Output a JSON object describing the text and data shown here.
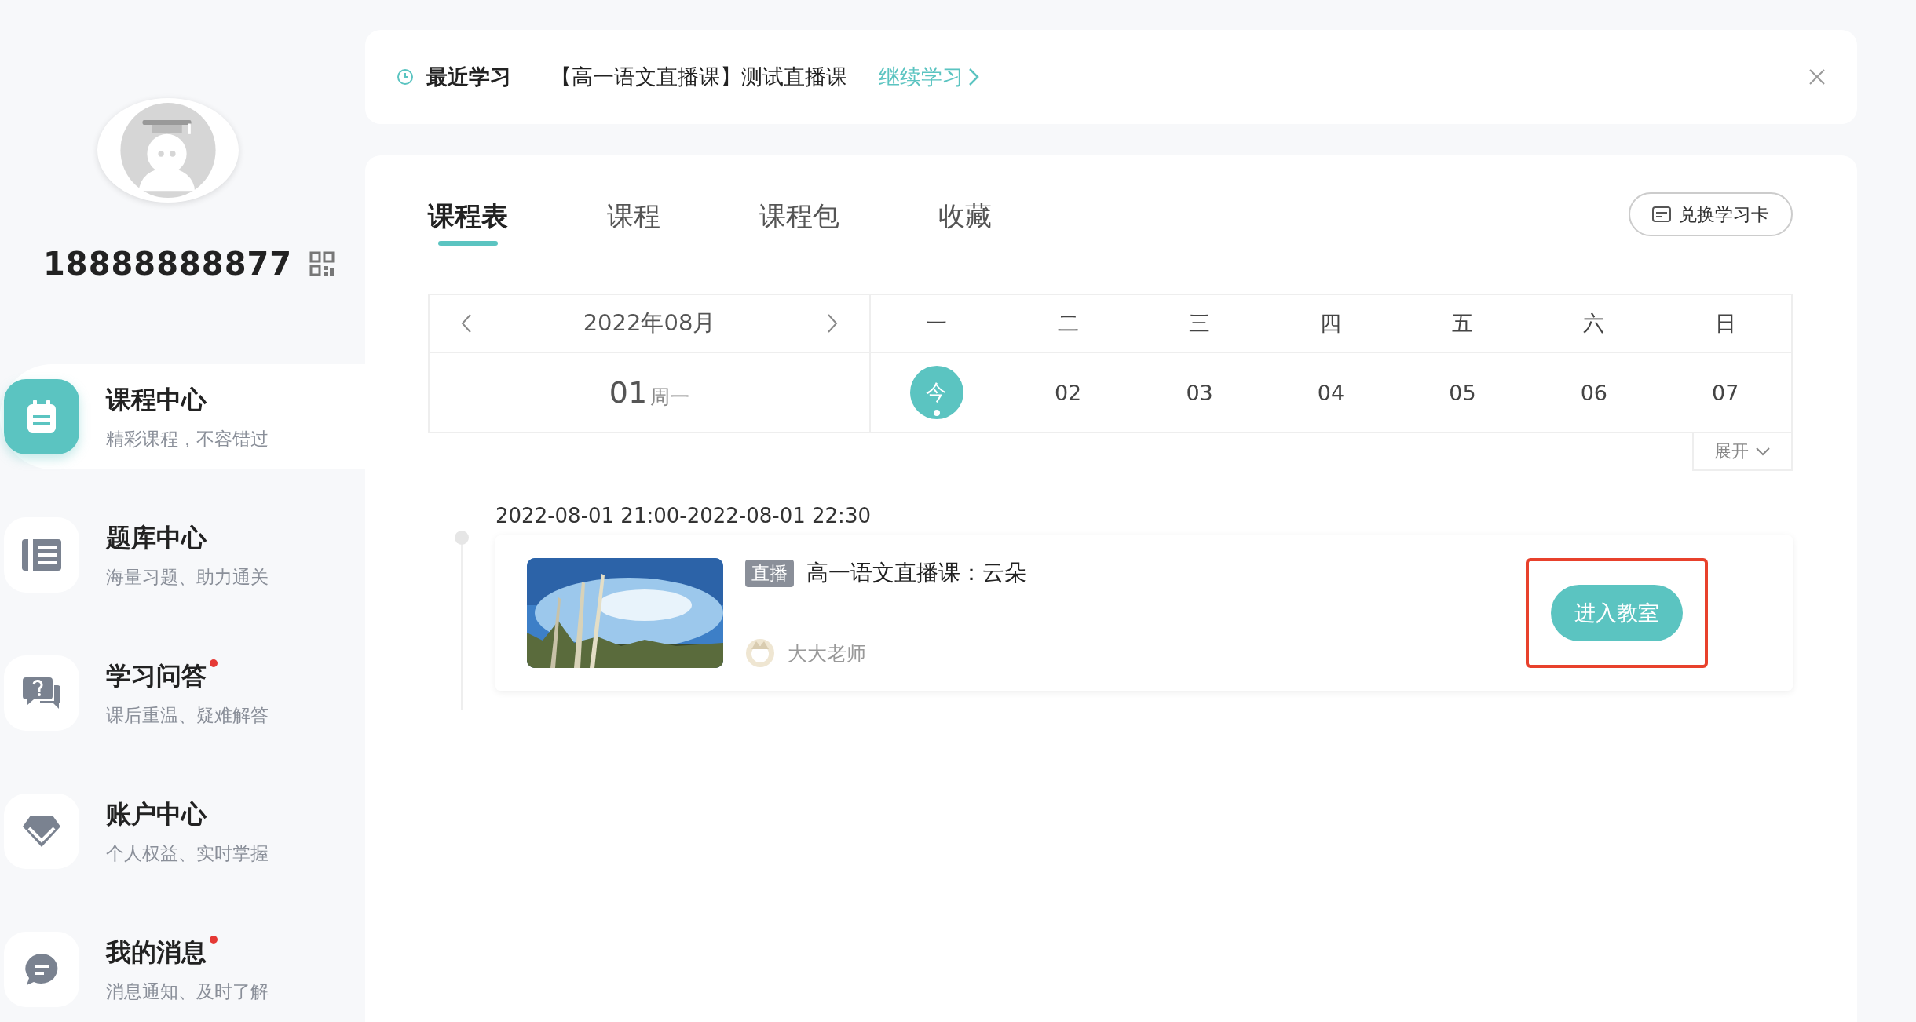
{
  "profile": {
    "phone": "18888888877"
  },
  "menu": [
    {
      "title": "课程中心",
      "subtitle": "精彩课程，不容错过",
      "selected": true,
      "unread": false,
      "kind": "calendar"
    },
    {
      "title": "题库中心",
      "subtitle": "海量习题、助力通关",
      "selected": false,
      "unread": false,
      "kind": "bank"
    },
    {
      "title": "学习问答",
      "subtitle": "课后重温、疑难解答",
      "selected": false,
      "unread": true,
      "kind": "qa"
    },
    {
      "title": "账户中心",
      "subtitle": "个人权益、实时掌握",
      "selected": false,
      "unread": false,
      "kind": "account"
    },
    {
      "title": "我的消息",
      "subtitle": "消息通知、及时了解",
      "selected": false,
      "unread": true,
      "kind": "message"
    }
  ],
  "recent": {
    "label": "最近学习",
    "course": "【高一语文直播课】测试直播课",
    "link": "继续学习"
  },
  "tabs": [
    {
      "label": "课程表",
      "selected": true
    },
    {
      "label": "课程",
      "selected": false
    },
    {
      "label": "课程包",
      "selected": false
    },
    {
      "label": "收藏",
      "selected": false
    }
  ],
  "redeem_button": "兑换学习卡",
  "calendar": {
    "month": "2022年08月",
    "day": "01",
    "weekday": "周一",
    "weekdays": [
      "一",
      "二",
      "三",
      "四",
      "五",
      "六",
      "日"
    ],
    "dates": [
      {
        "label": "今",
        "selected": true,
        "has_class": true
      },
      {
        "label": "02",
        "selected": false,
        "has_class": false
      },
      {
        "label": "03",
        "selected": false,
        "has_class": false
      },
      {
        "label": "04",
        "selected": false,
        "has_class": false
      },
      {
        "label": "05",
        "selected": false,
        "has_class": false
      },
      {
        "label": "06",
        "selected": false,
        "has_class": false
      },
      {
        "label": "07",
        "selected": false,
        "has_class": false
      }
    ],
    "expand": "展开"
  },
  "sessions": [
    {
      "time": "2022-08-01 21:00-2022-08-01 22:30",
      "tag": "直播",
      "title": "高一语文直播课：云朵",
      "teacher": "大大老师",
      "button": "进入教室",
      "highlighted": true
    }
  ]
}
